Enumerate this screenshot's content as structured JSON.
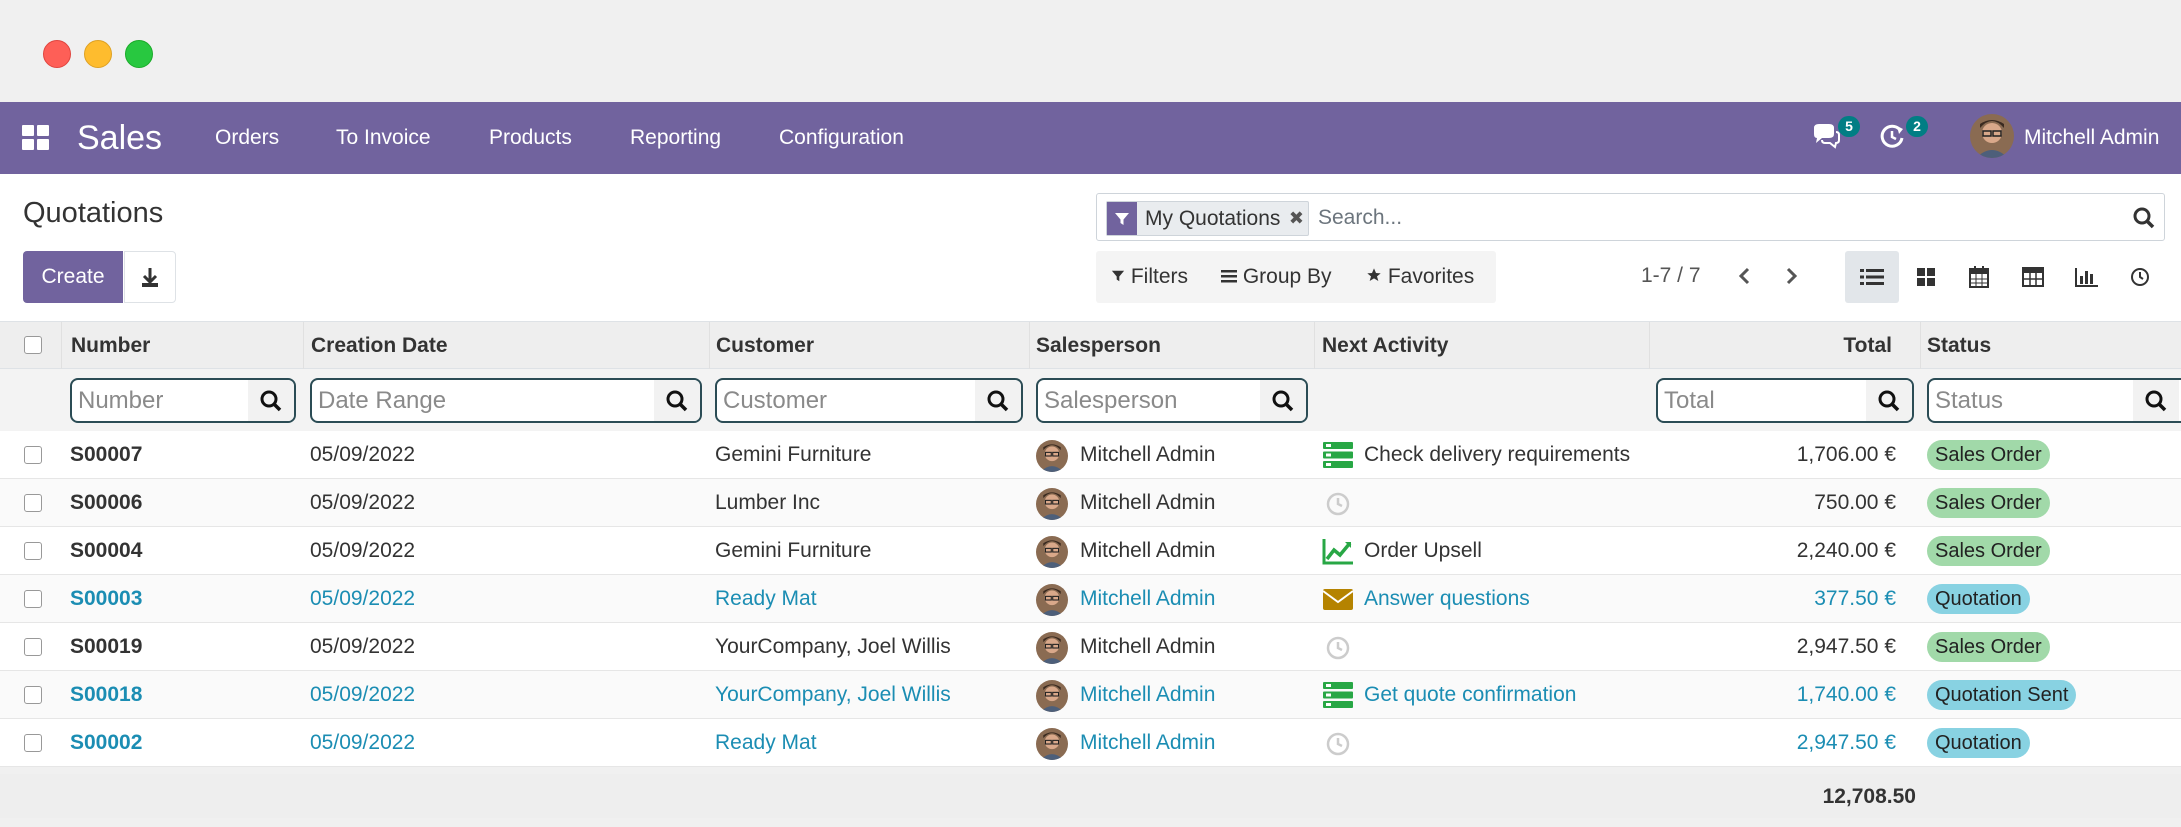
{
  "window": {
    "controls": [
      "close",
      "minimize",
      "maximize"
    ]
  },
  "navbar": {
    "app_name": "Sales",
    "menu": [
      "Orders",
      "To Invoice",
      "Products",
      "Reporting",
      "Configuration"
    ],
    "messages_count": "5",
    "activities_count": "2",
    "user_name": "Mitchell Admin",
    "color": "#71639e"
  },
  "control_panel": {
    "title": "Quotations",
    "create_label": "Create",
    "search": {
      "facet_label": "My Quotations",
      "placeholder": "Search..."
    },
    "filters_label": "Filters",
    "groupby_label": "Group By",
    "favorites_label": "Favorites",
    "pager_value": "1-7 / 7",
    "views": [
      "list",
      "kanban",
      "calendar",
      "pivot",
      "graph",
      "activity"
    ]
  },
  "table": {
    "headers": {
      "number": "Number",
      "creation_date": "Creation Date",
      "customer": "Customer",
      "salesperson": "Salesperson",
      "next_activity": "Next Activity",
      "total": "Total",
      "status": "Status"
    },
    "filters": {
      "number": "Number",
      "creation_date": "Date Range",
      "customer": "Customer",
      "salesperson": "Salesperson",
      "total": "Total",
      "status": "Status"
    },
    "rows": [
      {
        "number": "S00007",
        "date": "05/09/2022",
        "customer": "Gemini Furniture",
        "salesperson": "Mitchell Admin",
        "activity": "Check delivery requirements",
        "activity_icon": "tasks-icon",
        "total": "1,706.00 €",
        "status": "Sales Order",
        "highlight": false
      },
      {
        "number": "S00006",
        "date": "05/09/2022",
        "customer": "Lumber Inc",
        "salesperson": "Mitchell Admin",
        "activity": "",
        "activity_icon": "clock-icon",
        "total": "750.00 €",
        "status": "Sales Order",
        "highlight": false
      },
      {
        "number": "S00004",
        "date": "05/09/2022",
        "customer": "Gemini Furniture",
        "salesperson": "Mitchell Admin",
        "activity": "Order Upsell",
        "activity_icon": "chart-line-icon",
        "total": "2,240.00 €",
        "status": "Sales Order",
        "highlight": false
      },
      {
        "number": "S00003",
        "date": "05/09/2022",
        "customer": "Ready Mat",
        "salesperson": "Mitchell Admin",
        "activity": "Answer questions",
        "activity_icon": "envelope-icon",
        "total": "377.50 €",
        "status": "Quotation",
        "highlight": true
      },
      {
        "number": "S00019",
        "date": "05/09/2022",
        "customer": "YourCompany, Joel Willis",
        "salesperson": "Mitchell Admin",
        "activity": "",
        "activity_icon": "clock-icon",
        "total": "2,947.50 €",
        "status": "Sales Order",
        "highlight": false
      },
      {
        "number": "S00018",
        "date": "05/09/2022",
        "customer": "YourCompany, Joel Willis",
        "salesperson": "Mitchell Admin",
        "activity": "Get quote confirmation",
        "activity_icon": "tasks-icon",
        "total": "1,740.00 €",
        "status": "Quotation Sent",
        "highlight": true
      },
      {
        "number": "S00002",
        "date": "05/09/2022",
        "customer": "Ready Mat",
        "salesperson": "Mitchell Admin",
        "activity": "",
        "activity_icon": "clock-icon",
        "total": "2,947.50 €",
        "status": "Quotation",
        "highlight": true
      }
    ],
    "grand_total": "12,708.50"
  },
  "status_colors": {
    "Sales Order": "#a1d9a9",
    "Quotation": "#88d2e2",
    "Quotation Sent": "#88d2e2"
  },
  "link_color": "#1b8db3",
  "activity_icon_colors": {
    "tasks-icon": "#28a745",
    "chart-line-icon": "#28a745",
    "envelope-icon": "#b58300",
    "clock-icon": "#cccccc"
  }
}
